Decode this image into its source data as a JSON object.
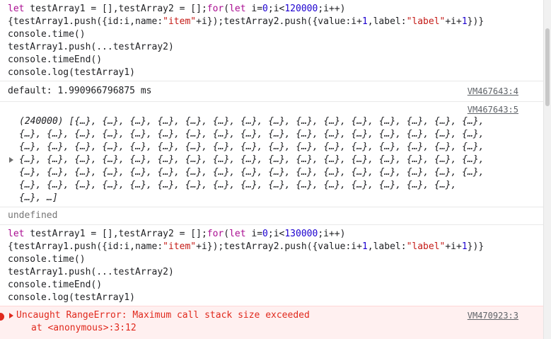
{
  "colors": {
    "keyword": "#aa0d91",
    "number": "#1c00cf",
    "string": "#c41a16",
    "error": "#e0291d",
    "error_bg": "#fff0f0"
  },
  "entry1": {
    "line1": {
      "a": "let",
      "b": " testArray1 = [],testArray2 = [];",
      "c": "for",
      "d": "(",
      "e": "let",
      "f": " i=",
      "g": "0",
      "h": ";i<",
      "i": "120000",
      "j": ";i++)"
    },
    "line2": {
      "a": "{testArray1.push({id:i,name:",
      "b": "\"item\"",
      "c": "+i});testArray2.push({value:i+",
      "d": "1",
      "e": ",label:",
      "f": "\"label\"",
      "g": "+i+",
      "h": "1",
      "i": "})}"
    },
    "line3": "console.time()",
    "line4": "testArray1.push(...testArray2)",
    "line5": "console.timeEnd()",
    "line6": "console.log(testArray1)"
  },
  "timer_output": {
    "text": "default: 1.990966796875 ms",
    "source": "VM467643:4"
  },
  "array_output": {
    "source": "VM467643:5",
    "lines": [
      "(240000) [{…}, {…}, {…}, {…}, {…}, {…}, {…}, {…}, {…}, {…}, {…}, {…}, {…}, {…}, {…},",
      "{…}, {…}, {…}, {…}, {…}, {…}, {…}, {…}, {…}, {…}, {…}, {…}, {…}, {…}, {…}, {…}, {…},",
      "{…}, {…}, {…}, {…}, {…}, {…}, {…}, {…}, {…}, {…}, {…}, {…}, {…}, {…}, {…}, {…}, {…},",
      "{…}, {…}, {…}, {…}, {…}, {…}, {…}, {…}, {…}, {…}, {…}, {…}, {…}, {…}, {…}, {…}, {…},",
      "{…}, {…}, {…}, {…}, {…}, {…}, {…}, {…}, {…}, {…}, {…}, {…}, {…}, {…}, {…}, {…}, {…},",
      "{…}, {…}, {…}, {…}, {…}, {…}, {…}, {…}, {…}, {…}, {…}, {…}, {…}, {…}, {…}, {…},",
      "{…}, …]"
    ]
  },
  "undefined_output": "undefined",
  "entry2": {
    "line1": {
      "a": "let",
      "b": " testArray1 = [],testArray2 = [];",
      "c": "for",
      "d": "(",
      "e": "let",
      "f": " i=",
      "g": "0",
      "h": ";i<",
      "i": "130000",
      "j": ";i++)"
    },
    "line2": {
      "a": "{testArray1.push({id:i,name:",
      "b": "\"item\"",
      "c": "+i});testArray2.push({value:i+",
      "d": "1",
      "e": ",label:",
      "f": "\"label\"",
      "g": "+i+",
      "h": "1",
      "i": "})}"
    },
    "line3": "console.time()",
    "line4": "testArray1.push(...testArray2)",
    "line5": "console.timeEnd()",
    "line6": "console.log(testArray1)"
  },
  "error": {
    "message": "Uncaught RangeError: Maximum call stack size exceeded",
    "stack": "at <anonymous>:3:12",
    "source": "VM470923:3",
    "icon": "error-icon"
  }
}
